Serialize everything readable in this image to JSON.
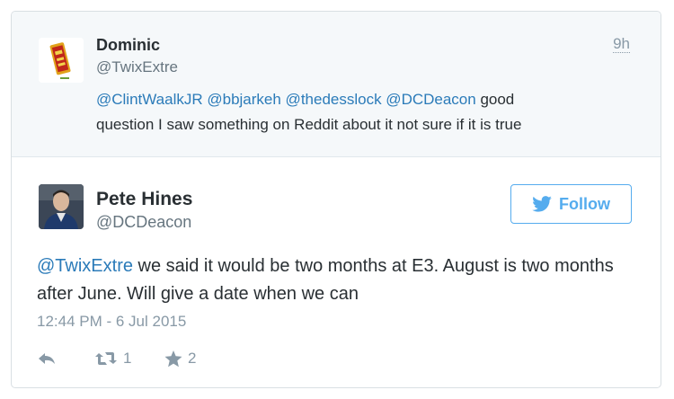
{
  "parent_tweet": {
    "author_name": "Dominic",
    "author_handle": "@TwixExtre",
    "time": "9h",
    "mentions": "@ClintWaalkJR @bbjarkeh @thedesslock @DCDeacon",
    "text_line1_rest": " good",
    "text_line2": "question I saw something on Reddit about it not sure if it is true",
    "avatar_icon": "twix-bar-avatar-icon"
  },
  "main_tweet": {
    "author_name": "Pete Hines",
    "author_handle": "@DCDeacon",
    "follow_label": "Follow",
    "mention": "@TwixExtre",
    "text_rest": " we said it would be two months at E3. August is two months after June. Will give a date when we can",
    "timestamp": "12:44 PM - 6 Jul 2015",
    "retweet_count": "1",
    "favorite_count": "2",
    "avatar_icon": "person-avatar-icon"
  },
  "colors": {
    "link": "#2b7bb9",
    "twitter_blue": "#55acee",
    "muted": "#8899a6",
    "text": "#292f33",
    "parent_bg": "#f5f8fa"
  }
}
